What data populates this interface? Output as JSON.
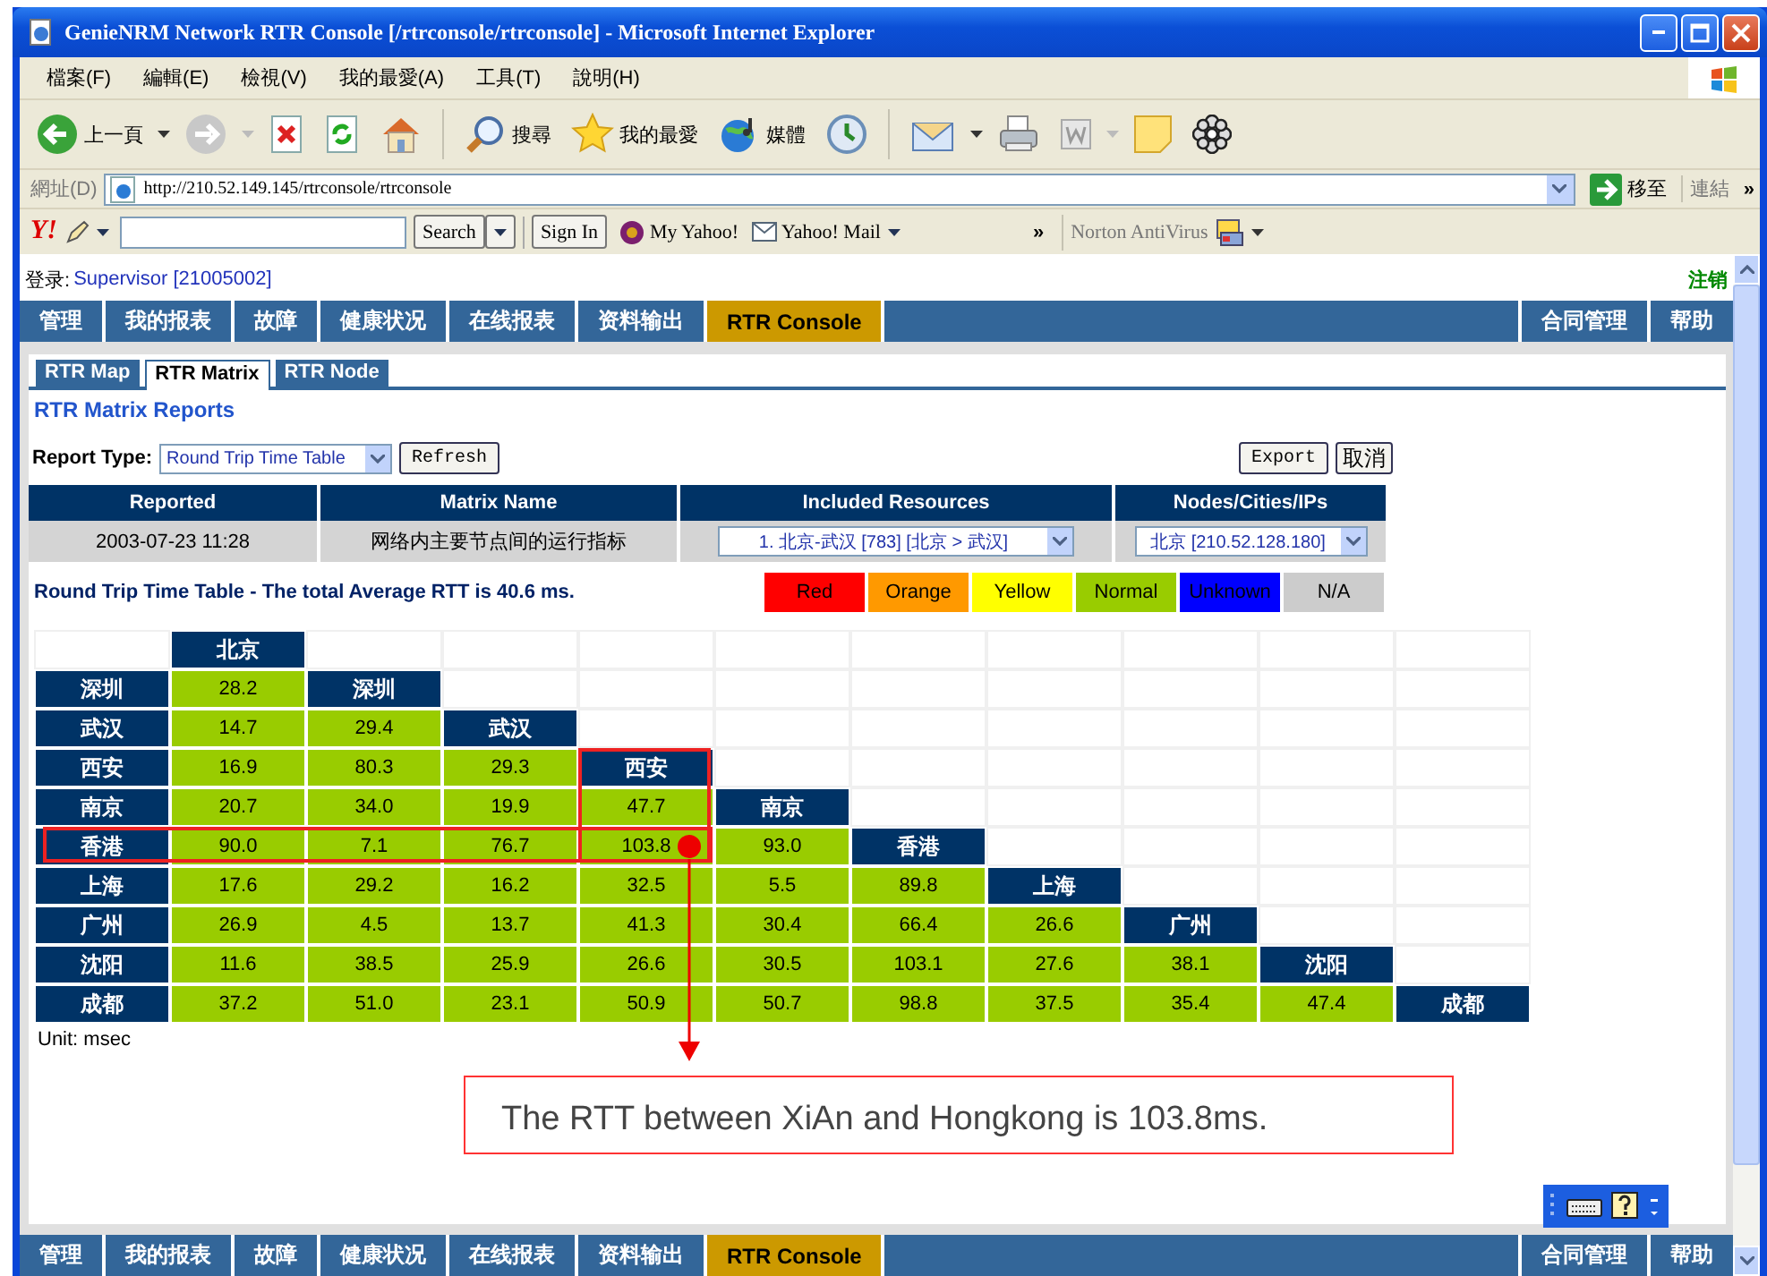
{
  "window": {
    "title": "GenieNRM Network RTR Console [/rtrconsole/rtrconsole] - Microsoft Internet Explorer"
  },
  "menu": [
    "檔案(F)",
    "編輯(E)",
    "檢視(V)",
    "我的最愛(A)",
    "工具(T)",
    "說明(H)"
  ],
  "toolbar": {
    "back": "上一頁",
    "search": "搜尋",
    "favorites": "我的最愛",
    "media": "媒體"
  },
  "address_bar": {
    "label": "網址(D)",
    "url": "http://210.52.149.145/rtrconsole/rtrconsole",
    "go": "移至",
    "links": "連結",
    "more": "»"
  },
  "yahoo_bar": {
    "logo": "Y!",
    "search": "Search",
    "sign_in": "Sign In",
    "my_yahoo": "My Yahoo!",
    "mail": "Yahoo! Mail",
    "more": "»",
    "norton": "Norton AntiVirus"
  },
  "login": {
    "label": "登录:",
    "user": "Supervisor [21005002]",
    "logout": "注销"
  },
  "nav": [
    {
      "label": "管理",
      "selected": false
    },
    {
      "label": "我的报表",
      "selected": false
    },
    {
      "label": "故障",
      "selected": false
    },
    {
      "label": "健康状况",
      "selected": false
    },
    {
      "label": "在线报表",
      "selected": false
    },
    {
      "label": "资料输出",
      "selected": false
    },
    {
      "label": "RTR Console",
      "selected": true
    }
  ],
  "nav_right": [
    "合同管理",
    "帮助"
  ],
  "tabs": [
    {
      "label": "RTR Map",
      "selected": false
    },
    {
      "label": "RTR Matrix",
      "selected": true
    },
    {
      "label": "RTR Node",
      "selected": false
    }
  ],
  "heading": "RTR Matrix Reports",
  "report_type": {
    "label": "Report Type:",
    "value": "Round Trip Time Table",
    "refresh": "Refresh",
    "export": "Export",
    "cancel": "取消"
  },
  "info_table": {
    "columns": [
      "Reported",
      "Matrix Name",
      "Included Resources",
      "Nodes/Cities/IPs"
    ],
    "row": {
      "reported": "2003-07-23 11:28",
      "matrix_name": "网络内主要节点间的运行指标",
      "resources": "1. 北京-武汉 [783] [北京 > 武汉]",
      "nodes": "北京 [210.52.128.180]"
    }
  },
  "summary": "Round Trip Time Table - The total Average RTT is 40.6 ms.",
  "legend": [
    {
      "label": "Red",
      "color": "#ff0000"
    },
    {
      "label": "Orange",
      "color": "#ff9900"
    },
    {
      "label": "Yellow",
      "color": "#ffff00"
    },
    {
      "label": "Normal",
      "color": "#99cc00"
    },
    {
      "label": "Unknown",
      "color": "#0000ff"
    },
    {
      "label": "N/A",
      "color": "#cccccc"
    }
  ],
  "matrix": {
    "top_label": "北京",
    "rows": [
      {
        "city": "深圳",
        "highlighted": false,
        "diagonal": "深圳",
        "cells": [
          {
            "value": "28.2",
            "color": "#99cc00",
            "highlighted": false
          }
        ]
      },
      {
        "city": "武汉",
        "highlighted": false,
        "diagonal": "武汉",
        "cells": [
          {
            "value": "14.7",
            "color": "#99cc00",
            "highlighted": false
          },
          {
            "value": "29.4",
            "color": "#99cc00",
            "highlighted": false
          }
        ]
      },
      {
        "city": "西安",
        "highlighted": false,
        "diagonal": "西安",
        "cells": [
          {
            "value": "16.9",
            "color": "#99cc00",
            "highlighted": false
          },
          {
            "value": "80.3",
            "color": "#99cc00",
            "highlighted": false
          },
          {
            "value": "29.3",
            "color": "#99cc00",
            "highlighted": false
          }
        ]
      },
      {
        "city": "南京",
        "highlighted": false,
        "diagonal": "南京",
        "cells": [
          {
            "value": "20.7",
            "color": "#99cc00",
            "highlighted": false
          },
          {
            "value": "34.0",
            "color": "#99cc00",
            "highlighted": false
          },
          {
            "value": "19.9",
            "color": "#99cc00",
            "highlighted": false
          },
          {
            "value": "47.7",
            "color": "#99cc00",
            "highlighted": false
          }
        ]
      },
      {
        "city": "香港",
        "highlighted": true,
        "diagonal": "香港",
        "cells": [
          {
            "value": "90.0",
            "color": "#99cc00",
            "highlighted": false
          },
          {
            "value": "7.1",
            "color": "#99cc00",
            "highlighted": false
          },
          {
            "value": "76.7",
            "color": "#99cc00",
            "highlighted": false
          },
          {
            "value": "103.8",
            "color": "#99cc00",
            "highlighted": true
          },
          {
            "value": "93.0",
            "color": "#99cc00",
            "highlighted": false
          }
        ]
      },
      {
        "city": "上海",
        "highlighted": false,
        "diagonal": "上海",
        "cells": [
          {
            "value": "17.6",
            "color": "#99cc00",
            "highlighted": false
          },
          {
            "value": "29.2",
            "color": "#99cc00",
            "highlighted": false
          },
          {
            "value": "16.2",
            "color": "#99cc00",
            "highlighted": false
          },
          {
            "value": "32.5",
            "color": "#99cc00",
            "highlighted": false
          },
          {
            "value": "5.5",
            "color": "#99cc00",
            "highlighted": false
          },
          {
            "value": "89.8",
            "color": "#99cc00",
            "highlighted": false
          }
        ]
      },
      {
        "city": "广州",
        "highlighted": false,
        "diagonal": "广州",
        "cells": [
          {
            "value": "26.9",
            "color": "#99cc00",
            "highlighted": false
          },
          {
            "value": "4.5",
            "color": "#99cc00",
            "highlighted": false
          },
          {
            "value": "13.7",
            "color": "#99cc00",
            "highlighted": false
          },
          {
            "value": "41.3",
            "color": "#99cc00",
            "highlighted": false
          },
          {
            "value": "30.4",
            "color": "#99cc00",
            "highlighted": false
          },
          {
            "value": "66.4",
            "color": "#99cc00",
            "highlighted": false
          },
          {
            "value": "26.6",
            "color": "#99cc00",
            "highlighted": false
          }
        ]
      },
      {
        "city": "沈阳",
        "highlighted": false,
        "diagonal": "沈阳",
        "cells": [
          {
            "value": "11.6",
            "color": "#99cc00",
            "highlighted": false
          },
          {
            "value": "38.5",
            "color": "#99cc00",
            "highlighted": false
          },
          {
            "value": "25.9",
            "color": "#99cc00",
            "highlighted": false
          },
          {
            "value": "26.6",
            "color": "#99cc00",
            "highlighted": false
          },
          {
            "value": "30.5",
            "color": "#99cc00",
            "highlighted": false
          },
          {
            "value": "103.1",
            "color": "#99cc00",
            "highlighted": false
          },
          {
            "value": "27.6",
            "color": "#99cc00",
            "highlighted": false
          },
          {
            "value": "38.1",
            "color": "#99cc00",
            "highlighted": false
          }
        ]
      },
      {
        "city": "成都",
        "highlighted": false,
        "diagonal": "成都",
        "cells": [
          {
            "value": "37.2",
            "color": "#99cc00",
            "highlighted": false
          },
          {
            "value": "51.0",
            "color": "#99cc00",
            "highlighted": false
          },
          {
            "value": "23.1",
            "color": "#99cc00",
            "highlighted": false
          },
          {
            "value": "50.9",
            "color": "#99cc00",
            "highlighted": false
          },
          {
            "value": "50.7",
            "color": "#99cc00",
            "highlighted": false
          },
          {
            "value": "98.8",
            "color": "#99cc00",
            "highlighted": false
          },
          {
            "value": "37.5",
            "color": "#99cc00",
            "highlighted": false
          },
          {
            "value": "35.4",
            "color": "#99cc00",
            "highlighted": false
          },
          {
            "value": "47.4",
            "color": "#99cc00",
            "highlighted": false
          }
        ]
      }
    ]
  },
  "unit": "Unit: msec",
  "callout": "The RTT between XiAn and Hongkong is 103.8ms.",
  "bottom_nav": [
    {
      "label": "管理",
      "selected": false
    },
    {
      "label": "我的报表",
      "selected": false
    },
    {
      "label": "故障",
      "selected": false
    },
    {
      "label": "健康状况",
      "selected": false
    },
    {
      "label": "在线报表",
      "selected": false
    },
    {
      "label": "资料输出",
      "selected": false
    },
    {
      "label": "RTR Console",
      "selected": true
    }
  ],
  "bottom_nav_right": [
    "合同管理",
    "帮助"
  ]
}
